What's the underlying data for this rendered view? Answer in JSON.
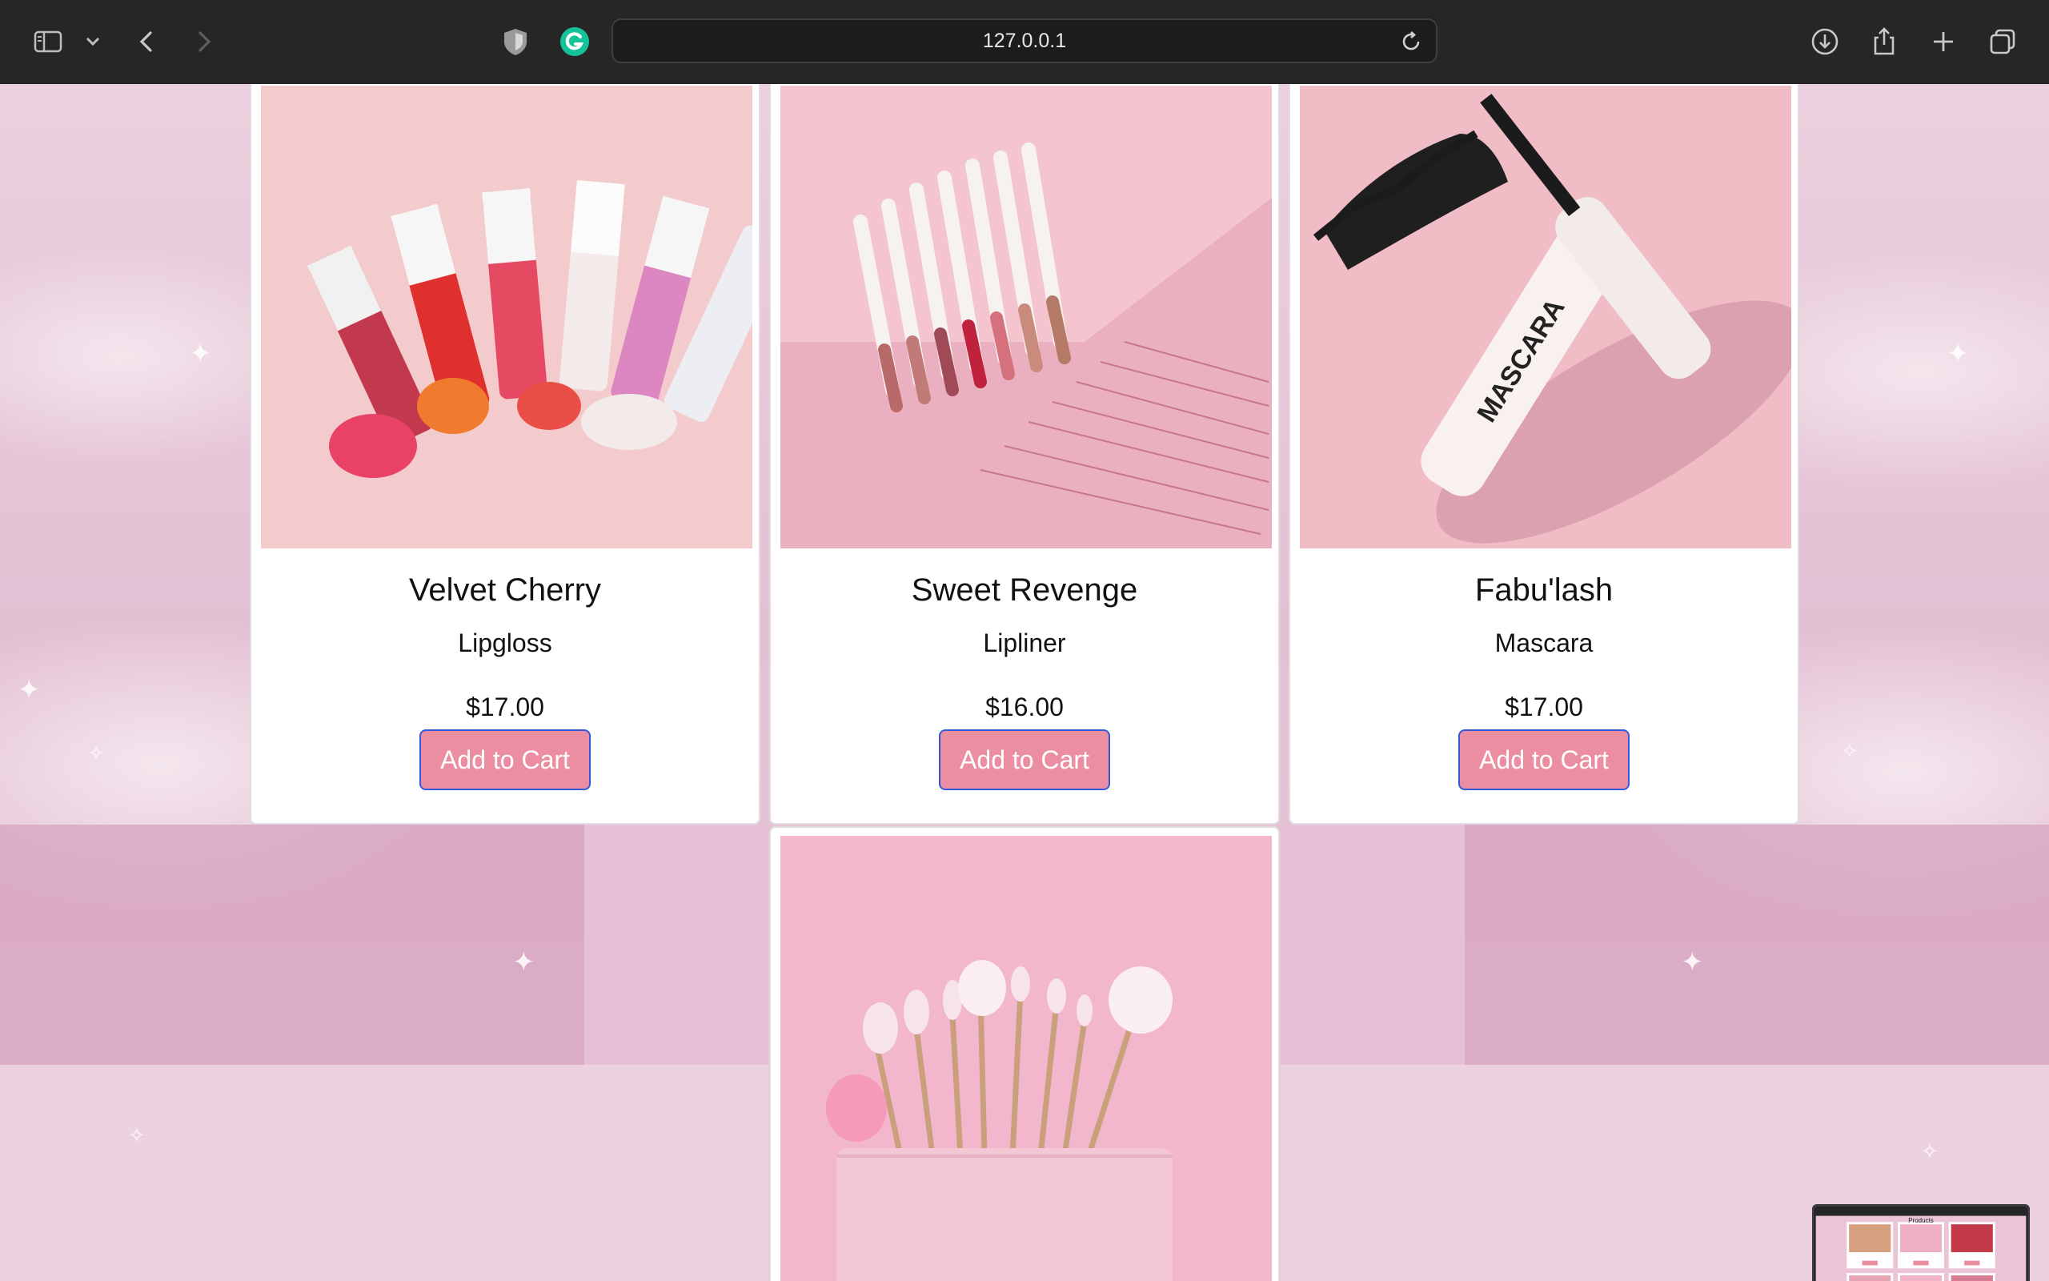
{
  "browser": {
    "url": "127.0.0.1",
    "icons": {
      "sidebar": "sidebar-icon",
      "chevron": "chevron-down-icon",
      "back": "back-arrow-icon",
      "forward": "forward-arrow-icon",
      "shield": "shield-icon",
      "grammarly": "grammarly-icon",
      "reload": "reload-icon",
      "download": "download-icon",
      "share": "share-icon",
      "new_tab": "plus-icon",
      "tabs": "tab-overview-icon"
    },
    "colors": {
      "chrome": "#262626",
      "url_field": "#1c1c1c"
    }
  },
  "products": [
    {
      "name": "Velvet Cherry",
      "type": "Lipgloss",
      "price": "$17.00",
      "button": "Add to Cart",
      "image": "lipgloss-tubes-photo"
    },
    {
      "name": "Sweet Revenge",
      "type": "Lipliner",
      "price": "$16.00",
      "button": "Add to Cart",
      "image": "lipliner-pencils-photo"
    },
    {
      "name": "Fabu'lash",
      "type": "Mascara",
      "price": "$17.00",
      "button": "Add to Cart",
      "image": "mascara-photo"
    },
    {
      "image": "makeup-brushes-photo"
    }
  ],
  "thumbnail": {
    "title": "Products"
  },
  "colors": {
    "button_bg": "#ec8ea1",
    "button_border": "#3058d8",
    "background": "#e9c3d6"
  }
}
